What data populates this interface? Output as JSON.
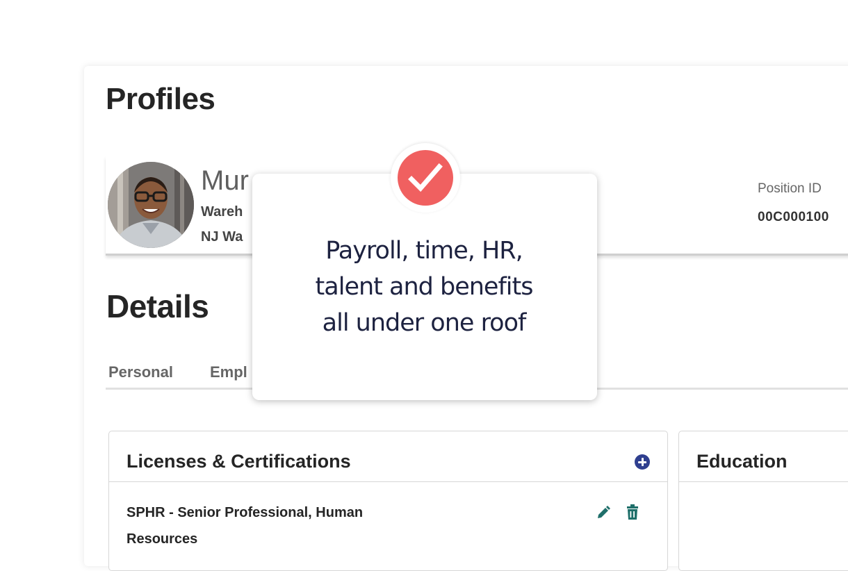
{
  "profiles": {
    "title": "Profiles",
    "employee": {
      "name": "Mur",
      "title": "Wareh",
      "location": "NJ Wa",
      "chevron": "‹"
    },
    "position": {
      "label": "Position ID",
      "value": "00C000100"
    }
  },
  "details": {
    "title": "Details",
    "tabs": [
      {
        "label": "Personal"
      },
      {
        "label": "Empl"
      }
    ]
  },
  "licenses": {
    "title": "Licenses & Certifications",
    "items": [
      {
        "name": "SPHR - Senior Professional, Human Resources"
      }
    ]
  },
  "education": {
    "title": "Education"
  },
  "tooltip": {
    "line1": "Payroll, time, HR,",
    "line2": "talent and benefits",
    "line3": "all under one roof"
  },
  "colors": {
    "accent_red": "#f06060",
    "add_blue": "#2f3f8f",
    "action_teal": "#1f6f6a",
    "tooltip_text": "#1d2240"
  },
  "icons": {
    "check": "check-icon",
    "add": "plus-circle-icon",
    "edit": "pencil-icon",
    "delete": "trash-icon"
  }
}
